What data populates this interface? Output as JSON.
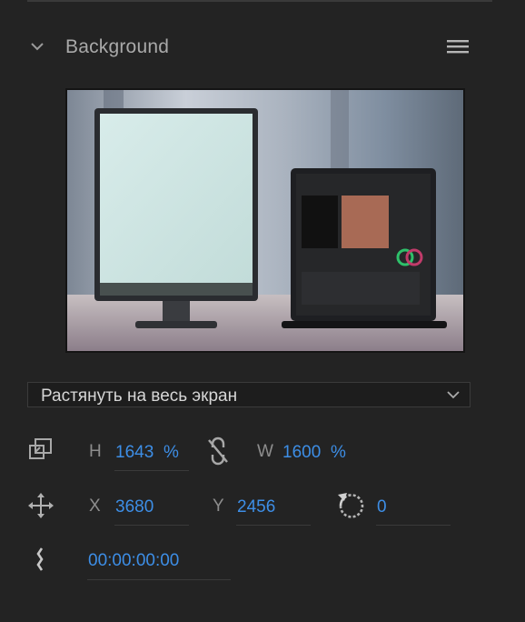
{
  "panel": {
    "title": "Background"
  },
  "fit_mode": {
    "selected": "Растянуть на весь экран"
  },
  "size": {
    "h_label": "H",
    "h_value": "1643",
    "h_unit": "%",
    "w_label": "W",
    "w_value": "1600",
    "w_unit": "%"
  },
  "position": {
    "x_label": "X",
    "x_value": "3680",
    "y_label": "Y",
    "y_value": "2456"
  },
  "rotation": {
    "value": "0"
  },
  "timecode": {
    "value": "00:00:00:00"
  },
  "icons": [
    "chevron-down-icon",
    "hamburger-menu-icon",
    "scale-icon",
    "unlink-icon",
    "move-icon",
    "rotate-icon",
    "keyframe-icon"
  ],
  "colors": {
    "background": "#232323",
    "accent_value": "#3d8ee6",
    "label": "#8d8d8d"
  }
}
